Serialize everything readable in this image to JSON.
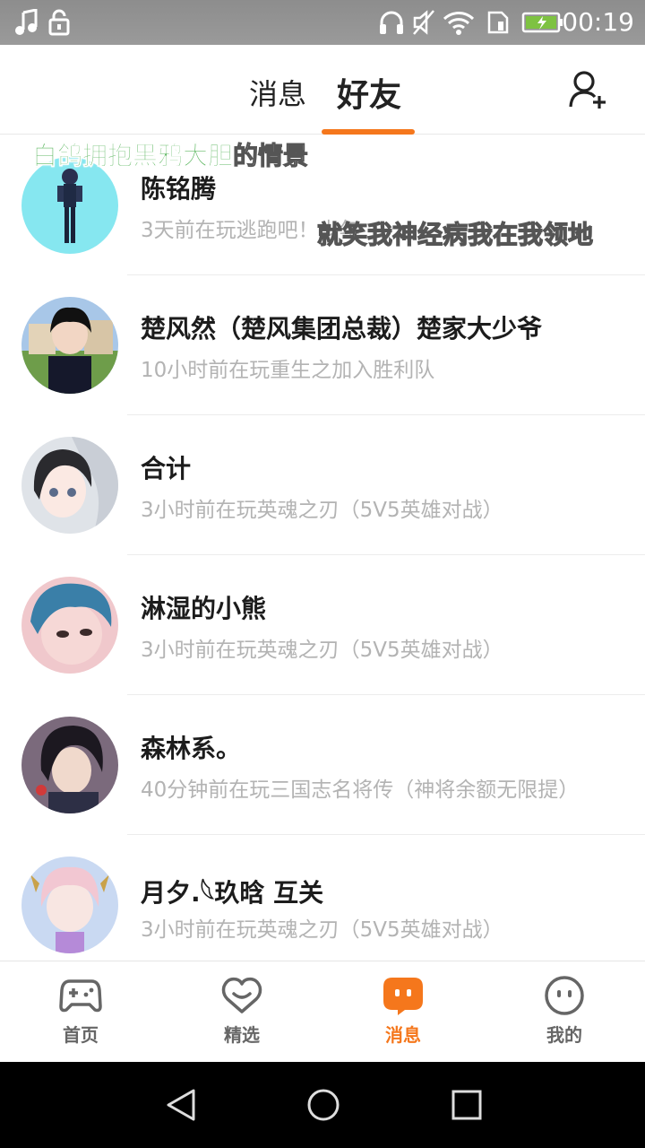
{
  "status_bar": {
    "time": "00:19",
    "icons": [
      "music-note-icon",
      "lock-icon",
      "headphones-icon",
      "mute-icon",
      "wifi-icon",
      "sim-icon",
      "battery-charging-icon"
    ]
  },
  "header": {
    "tabs": [
      {
        "label": "消息",
        "active": false
      },
      {
        "label": "好友",
        "active": true
      }
    ],
    "add_friend_icon": "add-friend-icon",
    "accent_color": "#f5771c"
  },
  "friends": [
    {
      "name": "陈铭腾",
      "status": "3天前在玩逃跑吧！少年"
    },
    {
      "name": "楚风然（楚风集团总裁）楚家大少爷",
      "status": "10小时前在玩重生之加入胜利队"
    },
    {
      "name": "合计",
      "status": "3小时前在玩英魂之刃（5V5英雄对战）"
    },
    {
      "name": "淋湿的小熊",
      "status": "3小时前在玩英魂之刃（5V5英雄对战）"
    },
    {
      "name": "森林系。",
      "status": "40分钟前在玩三国志名将传（神将余额无限提）"
    },
    {
      "name": "月夕.𓆩玖晗 互关",
      "status": "3小时前在玩英魂之刃（5V5英雄对战）"
    }
  ],
  "danmaku": {
    "line1_green": "白鸽拥抱黑鸦大胆",
    "line1_tail": "的情景",
    "line2": "就笑我神经病我在我领地"
  },
  "bottom_nav": [
    {
      "label": "首页",
      "icon": "gamepad-icon",
      "active": false
    },
    {
      "label": "精选",
      "icon": "heart-chat-icon",
      "active": false
    },
    {
      "label": "消息",
      "icon": "message-bubble-icon",
      "active": true
    },
    {
      "label": "我的",
      "icon": "smiley-face-icon",
      "active": false
    }
  ],
  "system_nav": [
    "back-icon",
    "home-icon",
    "recents-icon"
  ]
}
